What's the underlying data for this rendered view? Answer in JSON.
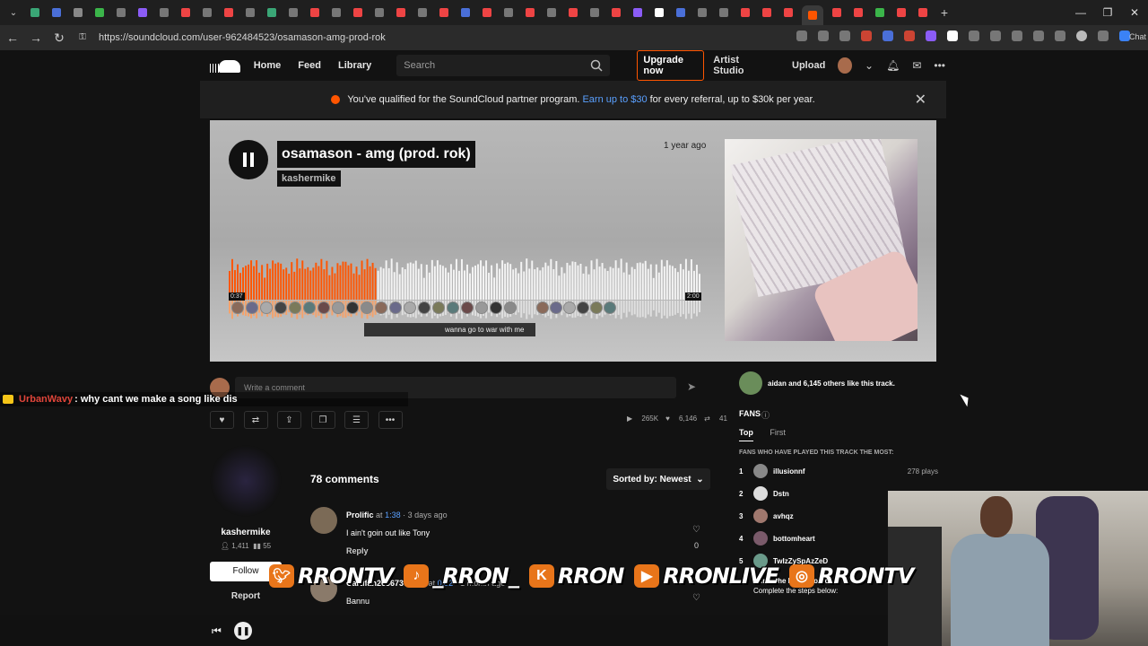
{
  "browser": {
    "url": "https://soundcloud.com/user-962484523/osamason-amg-prod-rok",
    "window_controls": [
      "—",
      "❐",
      "✕"
    ],
    "profile_label": "Chat"
  },
  "sc_nav": {
    "home": "Home",
    "feed": "Feed",
    "library": "Library",
    "search_placeholder": "Search",
    "upgrade": "Upgrade now",
    "artist_studio": "Artist Studio",
    "upload": "Upload"
  },
  "banner": {
    "text_before": "You've qualified for the SoundCloud partner program.",
    "link": "Earn up to $30",
    "text_after": "for every referral, up to $30k per year."
  },
  "track": {
    "title": "osamason - amg (prod. rok)",
    "artist": "kashermike",
    "posted": "1 year ago",
    "current_time": "0:37",
    "total_time": "2:00",
    "progress": 0.31,
    "waveform_comment": "wanna go to war with me"
  },
  "comment_box": {
    "placeholder": "Write a comment"
  },
  "chat": {
    "user": "UrbanWavy",
    "message": ": why cant we make a song like dis"
  },
  "stats": {
    "plays": "265K",
    "likes": "6,146",
    "reposts": "41"
  },
  "artist_card": {
    "name": "kashermike",
    "followers": "1,411",
    "tracks": "55",
    "follow": "Follow",
    "report": "Report"
  },
  "comments": {
    "count": "78 comments",
    "sort": "Sorted by: Newest",
    "items": [
      {
        "user": "Prolific",
        "at": "at",
        "ts": "1:38",
        "ago": "· 3 days ago",
        "text": "I ain't goin out like Tony",
        "reply": "Reply",
        "likes": "0"
      },
      {
        "user": "Cartifan26367373737",
        "at": "at",
        "ts": "0:02",
        "ago": "· 1 month ago",
        "text": "Bannu",
        "reply": "Reply",
        "likes": ""
      }
    ]
  },
  "sidebar": {
    "likes_text": "aidan and 6,145 others like this track.",
    "fans_title": "FANS",
    "tab_top": "Top",
    "tab_first": "First",
    "fans_sub": "FANS WHO HAVE PLAYED THIS TRACK THE MOST:",
    "fans": [
      {
        "rank": "1",
        "name": "illusionnf",
        "plays": "278 plays"
      },
      {
        "rank": "2",
        "name": "Dstn",
        "plays": ""
      },
      {
        "rank": "3",
        "name": "avhqz",
        "plays": ""
      },
      {
        "rank": "4",
        "name": "bottomheart",
        "plays": ""
      },
      {
        "rank": "5",
        "name": "TwIzZySpAzZeD",
        "plays": ""
      }
    ],
    "climb_line1": "Climb the leaderboard",
    "climb_line2": "Complete the steps below:"
  },
  "socials": [
    {
      "icon": "twitter-icon",
      "handle": "RRONTV",
      "color": "#e8751a"
    },
    {
      "icon": "tiktok-icon",
      "handle": "_RRON_",
      "color": "#e8751a"
    },
    {
      "icon": "kick-icon",
      "handle": "RRON",
      "color": "#e8751a"
    },
    {
      "icon": "youtube-icon",
      "handle": "RRONLIVE",
      "color": "#e8751a"
    },
    {
      "icon": "instagram-icon",
      "handle": "RRONTV",
      "color": "#e8751a"
    }
  ],
  "colors": {
    "accent": "#ff5500",
    "link": "#5aa0ff",
    "chat_user": "#e0453a"
  }
}
